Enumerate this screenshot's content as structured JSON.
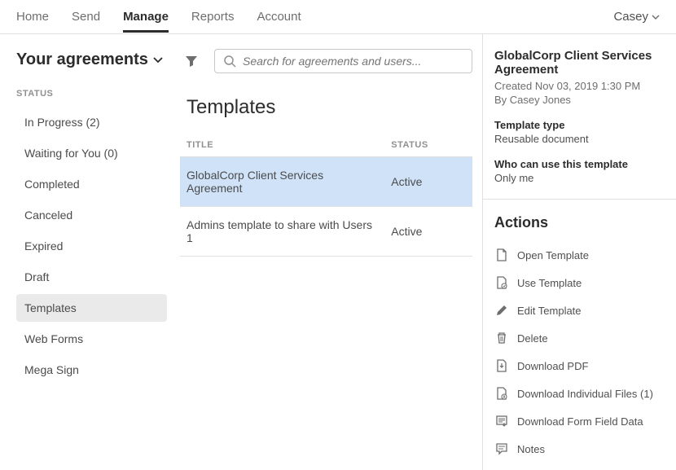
{
  "nav": {
    "items": [
      "Home",
      "Send",
      "Manage",
      "Reports",
      "Account"
    ],
    "active_index": 2,
    "user": "Casey"
  },
  "sidebar": {
    "title": "Your agreements",
    "section_label": "STATUS",
    "items": [
      {
        "label": "In Progress (2)"
      },
      {
        "label": "Waiting for You (0)"
      },
      {
        "label": "Completed"
      },
      {
        "label": "Canceled"
      },
      {
        "label": "Expired"
      },
      {
        "label": "Draft"
      },
      {
        "label": "Templates",
        "selected": true
      },
      {
        "label": "Web Forms"
      },
      {
        "label": "Mega Sign"
      }
    ]
  },
  "search": {
    "placeholder": "Search for agreements and users..."
  },
  "content": {
    "title": "Templates",
    "columns": {
      "title": "TITLE",
      "status": "STATUS"
    },
    "rows": [
      {
        "title": "GlobalCorp Client Services Agreement",
        "status": "Active",
        "selected": true
      },
      {
        "title": "Admins template to share with Users 1",
        "status": "Active"
      }
    ]
  },
  "panel": {
    "title": "GlobalCorp Client Services Agreement",
    "created_label": "Created Nov 03, 2019 1:30 PM",
    "by_label": "By Casey Jones",
    "template_type_label": "Template type",
    "template_type_value": "Reusable document",
    "who_label": "Who can use this template",
    "who_value": "Only me",
    "actions_title": "Actions",
    "actions": [
      {
        "label": "Open Template",
        "icon": "open"
      },
      {
        "label": "Use Template",
        "icon": "use"
      },
      {
        "label": "Edit Template",
        "icon": "edit"
      },
      {
        "label": "Delete",
        "icon": "trash"
      },
      {
        "label": "Download PDF",
        "icon": "download"
      },
      {
        "label": "Download Individual Files (1)",
        "icon": "download-multi"
      },
      {
        "label": "Download Form Field Data",
        "icon": "download-form"
      },
      {
        "label": "Notes",
        "icon": "notes"
      }
    ]
  }
}
